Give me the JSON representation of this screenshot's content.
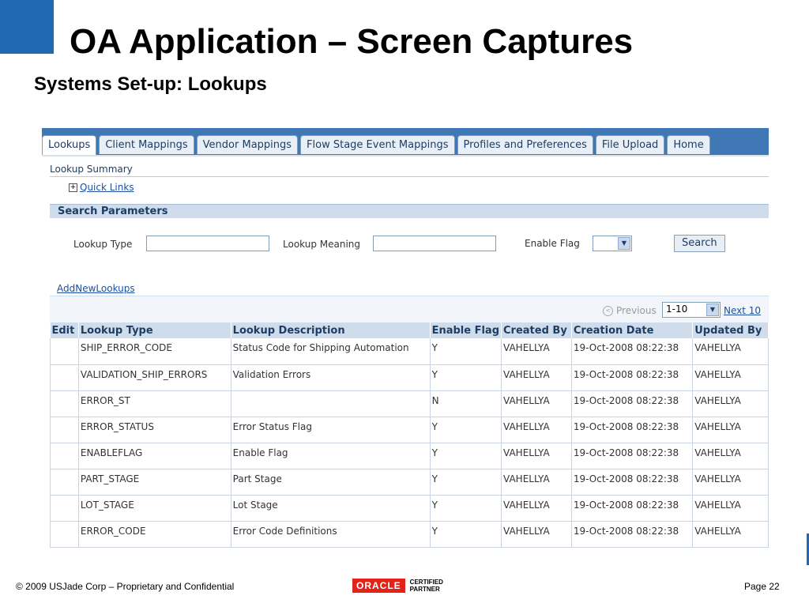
{
  "slide": {
    "title": "OA Application – Screen Captures",
    "subtitle": "Systems Set-up: Lookups",
    "footer": "© 2009 USJade Corp – Proprietary and Confidential",
    "page": "Page 22",
    "logo_text": "ORACLE",
    "logo_badge_line1": "CERTIFIED",
    "logo_badge_line2": "PARTNER",
    "accent": "#1f6ab0"
  },
  "app": {
    "tabs": [
      {
        "label": "Lookups",
        "active": true
      },
      {
        "label": "Client Mappings"
      },
      {
        "label": "Vendor Mappings"
      },
      {
        "label": "Flow Stage Event Mappings"
      },
      {
        "label": "Profiles and Preferences"
      },
      {
        "label": "File Upload"
      },
      {
        "label": "Home"
      }
    ],
    "page_header": "Lookup Summary",
    "quick_links": "Quick Links",
    "search": {
      "header": "Search Parameters",
      "lookup_type_label": "Lookup Type",
      "lookup_type_value": "",
      "lookup_meaning_label": "Lookup Meaning",
      "lookup_meaning_value": "",
      "enable_flag_label": "Enable Flag",
      "enable_flag_value": "",
      "search_button": "Search"
    },
    "add_link": "AddNewLookups",
    "pagination": {
      "previous": "Previous",
      "range": "1-10",
      "next": "Next 10"
    },
    "table": {
      "columns": [
        "Edit",
        "Lookup Type",
        "Lookup Description",
        "Enable Flag",
        "Created By",
        "Creation Date",
        "Updated By"
      ],
      "rows": [
        [
          "",
          "SHIP_ERROR_CODE",
          "Status Code for Shipping Automation",
          "Y",
          "VAHELLYA",
          "19-Oct-2008 08:22:38",
          "VAHELLYA"
        ],
        [
          "",
          "VALIDATION_SHIP_ERRORS",
          "Validation Errors",
          "Y",
          "VAHELLYA",
          "19-Oct-2008 08:22:38",
          "VAHELLYA"
        ],
        [
          "",
          "ERROR_ST",
          "",
          "N",
          "VAHELLYA",
          "19-Oct-2008 08:22:38",
          "VAHELLYA"
        ],
        [
          "",
          "ERROR_STATUS",
          "Error Status Flag",
          "Y",
          "VAHELLYA",
          "19-Oct-2008 08:22:38",
          "VAHELLYA"
        ],
        [
          "",
          "ENABLEFLAG",
          "Enable Flag",
          "Y",
          "VAHELLYA",
          "19-Oct-2008 08:22:38",
          "VAHELLYA"
        ],
        [
          "",
          "PART_STAGE",
          "Part Stage",
          "Y",
          "VAHELLYA",
          "19-Oct-2008 08:22:38",
          "VAHELLYA"
        ],
        [
          "",
          "LOT_STAGE",
          "Lot Stage",
          "Y",
          "VAHELLYA",
          "19-Oct-2008 08:22:38",
          "VAHELLYA"
        ],
        [
          "",
          "ERROR_CODE",
          "Error Code Definitions",
          "Y",
          "VAHELLYA",
          "19-Oct-2008 08:22:38",
          "VAHELLYA"
        ]
      ]
    }
  }
}
